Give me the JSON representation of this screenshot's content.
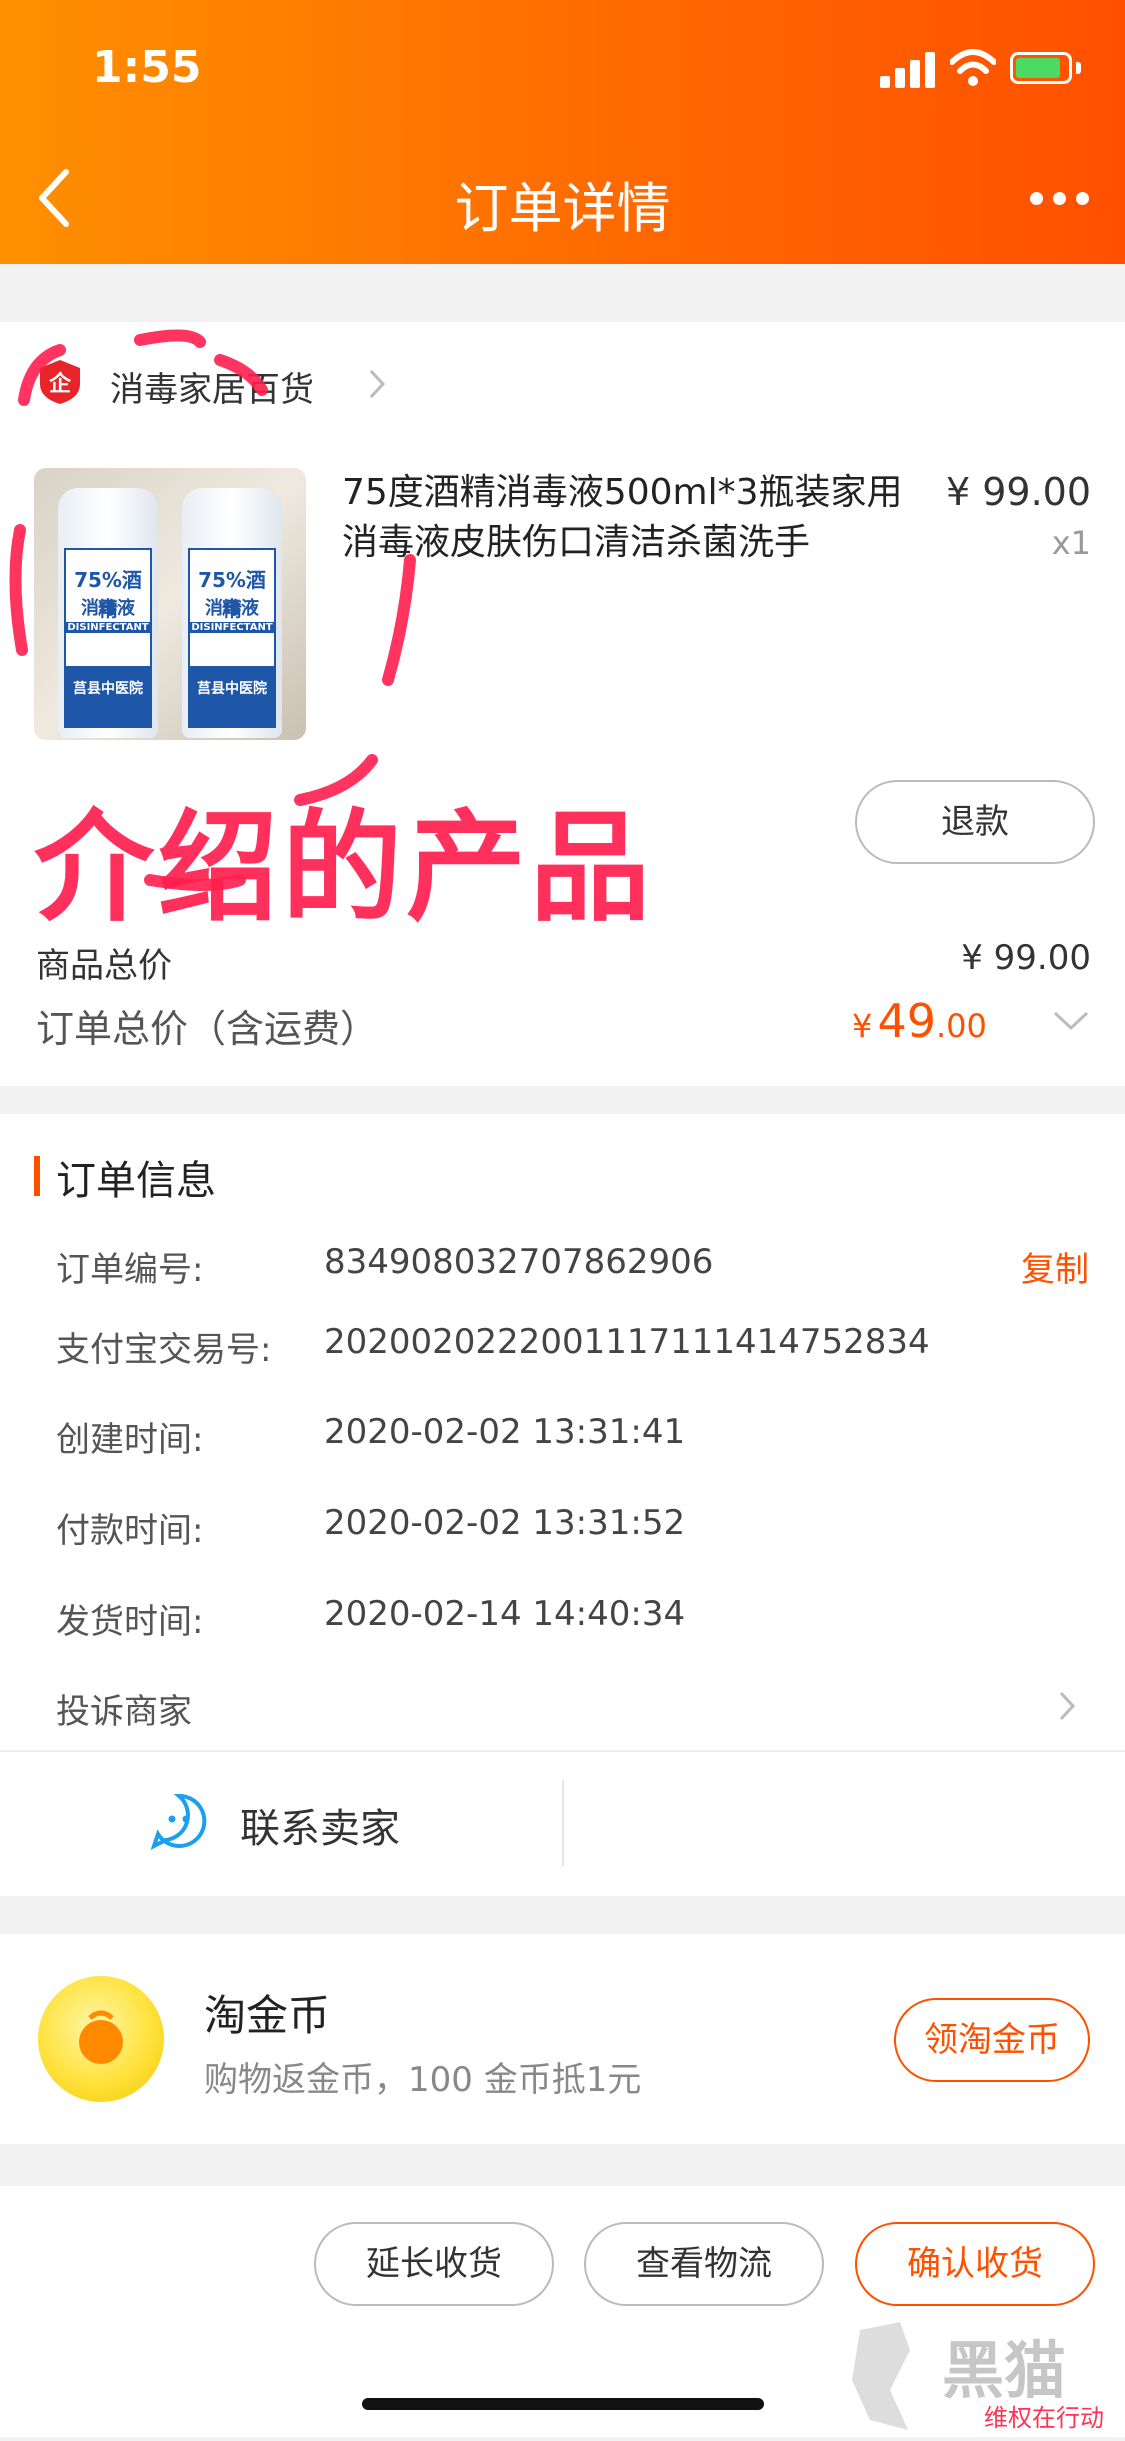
{
  "status_bar": {
    "time": "1:55"
  },
  "nav": {
    "title": "订单详情"
  },
  "shop": {
    "name": "消毒家居百货",
    "badge": "企"
  },
  "product": {
    "title": "75度酒精消毒液500ml*3瓶装家用消毒液皮肤伤口清洁杀菌洗手",
    "price": "¥ 99.00",
    "qty": "x1",
    "image_label_main": "75%酒精",
    "image_label_sub": "消毒液",
    "image_label_en": "DISINFECTANT",
    "image_label_brand": "莒县中医院"
  },
  "annotation": "介绍的产品",
  "refund_button": "退款",
  "totals": {
    "goods_label": "商品总价",
    "goods_value": "¥ 99.00",
    "order_label": "订单总价（含运费）",
    "order_currency": "¥",
    "order_int": "49",
    "order_dec": ".00"
  },
  "order_info": {
    "title": "订单信息",
    "rows": [
      {
        "label": "订单编号:",
        "value": "834908032707862906"
      },
      {
        "label": "支付宝交易号:",
        "value": "2020020222001117111414752834"
      },
      {
        "label": "创建时间:",
        "value": "2020-02-02 13:31:41"
      },
      {
        "label": "付款时间:",
        "value": "2020-02-02 13:31:52"
      },
      {
        "label": "发货时间:",
        "value": "2020-02-14 14:40:34"
      }
    ],
    "copy_label": "复制",
    "complaint": "投诉商家",
    "contact_seller": "联系卖家"
  },
  "coins": {
    "title": "淘金币",
    "subtitle": "购物返金币，100 金币抵1元",
    "button": "领淘金币"
  },
  "actions": {
    "extend": "延长收货",
    "logistics": "查看物流",
    "confirm": "确认收货"
  },
  "watermark": {
    "text": "黑猫",
    "sub": "维权在行动"
  },
  "colors": {
    "accent": "#ff5000",
    "header_start": "#ff9000",
    "annotation": "#ff1f4f"
  }
}
